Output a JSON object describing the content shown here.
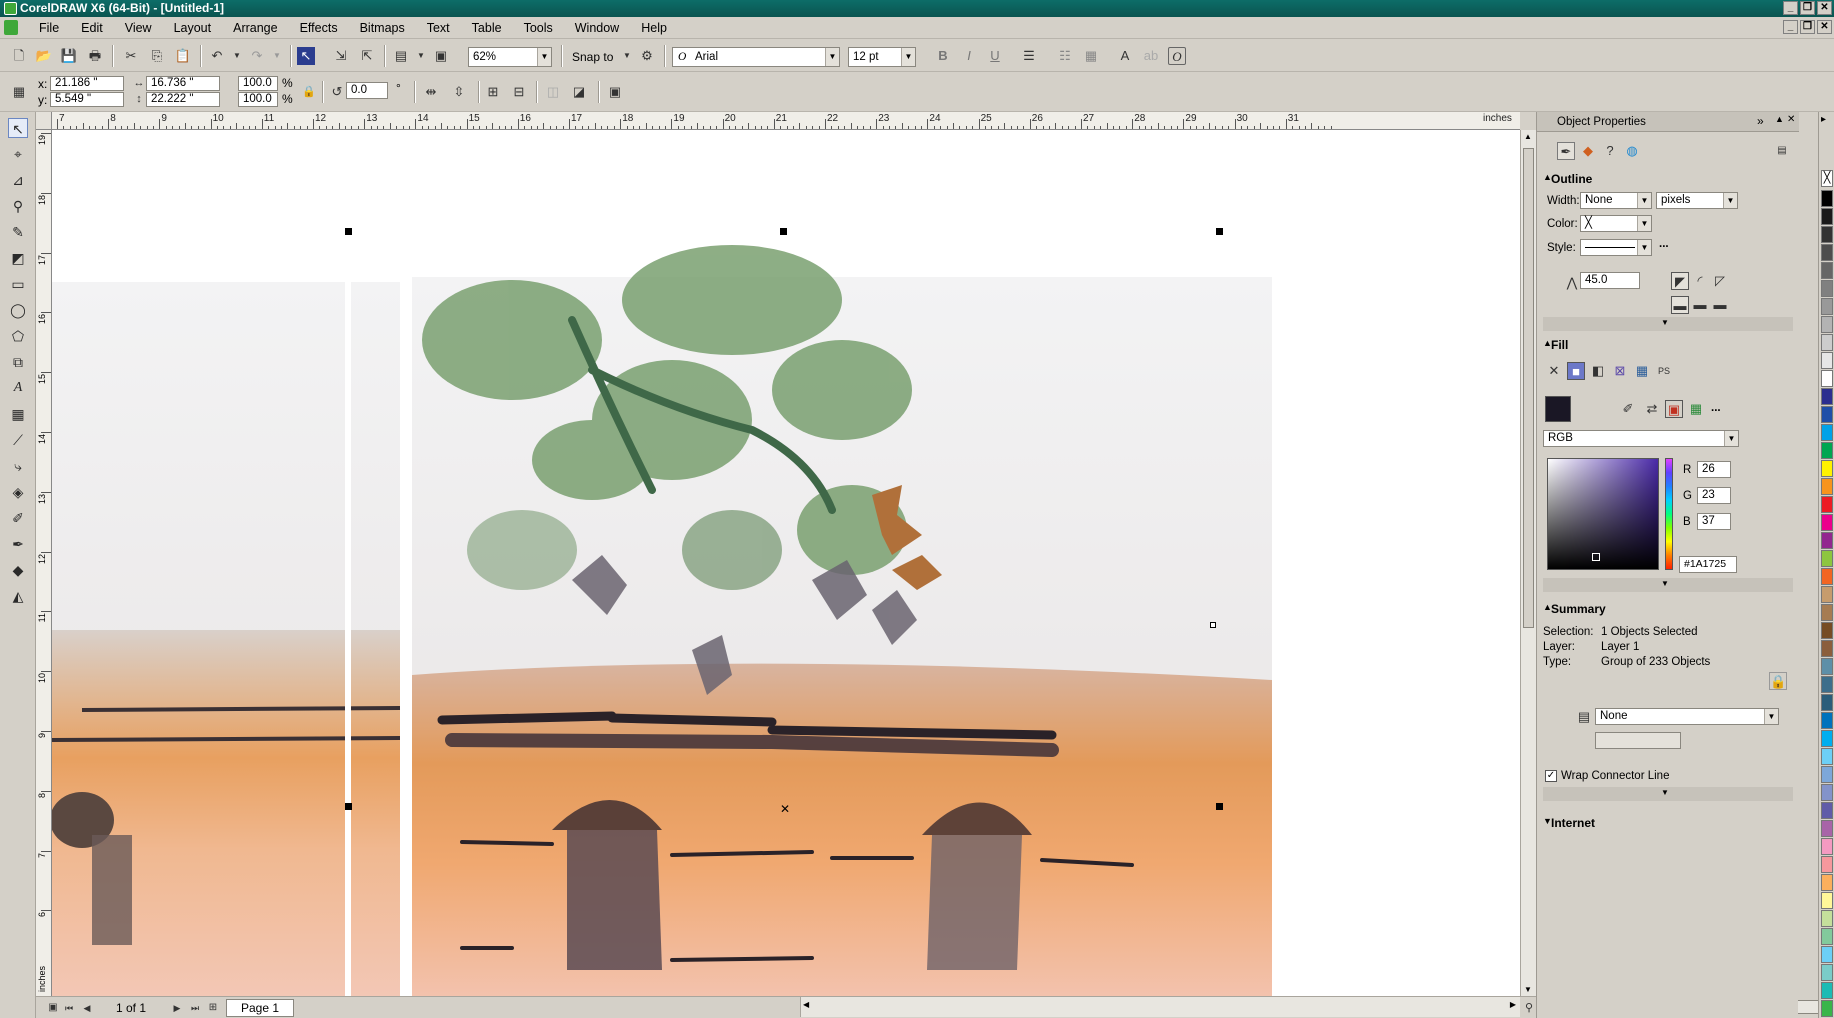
{
  "window": {
    "title": "CorelDRAW X6 (64-Bit) - [Untitled-1]"
  },
  "menu": [
    "File",
    "Edit",
    "View",
    "Layout",
    "Arrange",
    "Effects",
    "Bitmaps",
    "Text",
    "Table",
    "Tools",
    "Window",
    "Help"
  ],
  "toolbar": {
    "zoom": "62%",
    "snap_label": "Snap to",
    "font_name": "Arial",
    "font_size": "12 pt"
  },
  "propbar": {
    "x_label": "x:",
    "x_value": "21.186 \"",
    "y_label": "y:",
    "y_value": "5.549 \"",
    "width_value": "16.736 \"",
    "height_value": "22.222 \"",
    "scale_w": "100.0",
    "scale_h": "100.0",
    "percent": "%",
    "rotation": "0.0",
    "degree": "°"
  },
  "ruler": {
    "unit": "inches",
    "top_labels": [
      "7",
      "8",
      "9",
      "10",
      "11",
      "12",
      "13",
      "14",
      "15",
      "16",
      "17",
      "18",
      "19",
      "20",
      "21",
      "22",
      "23",
      "24",
      "25",
      "26",
      "27",
      "28",
      "29",
      "30",
      "31"
    ],
    "left_labels": [
      "19",
      "18",
      "17",
      "16",
      "15",
      "14",
      "13",
      "12",
      "11",
      "10",
      "9",
      "8",
      "7",
      "6"
    ],
    "left_unit": "inches"
  },
  "status": {
    "page_count": "1 of 1",
    "page_tab": "Page 1"
  },
  "panel": {
    "title": "Object Properties",
    "outline": {
      "header": "Outline",
      "width_label": "Width:",
      "width_value": "None",
      "unit_value": "pixels",
      "color_label": "Color:",
      "style_label": "Style:",
      "style_more": "...",
      "miter_value": "45.0"
    },
    "fill": {
      "header": "Fill",
      "model": "RGB",
      "more": "...",
      "r_label": "R",
      "r_value": "26",
      "g_label": "G",
      "g_value": "23",
      "b_label": "B",
      "b_value": "37",
      "hex": "#1A1725",
      "swatch_color": "#1a1725"
    },
    "summary": {
      "header": "Summary",
      "selection_label": "Selection:",
      "selection_value": "1 Objects Selected",
      "layer_label": "Layer:",
      "layer_value": "Layer 1",
      "type_label": "Type:",
      "type_value": "Group of 233 Objects",
      "style_value": "None",
      "wrap_label": "Wrap Connector Line",
      "wrap_checked": true
    },
    "internet": {
      "header": "Internet"
    }
  },
  "palette": [
    "#000000",
    "#1a1a1a",
    "#333333",
    "#4d4d4d",
    "#666666",
    "#808080",
    "#999999",
    "#b3b3b3",
    "#cccccc",
    "#e6e6e6",
    "#ffffff",
    "#2b2e8f",
    "#1f4fa8",
    "#00a2e8",
    "#00a651",
    "#fff200",
    "#f7941d",
    "#ed1c24",
    "#ec008c",
    "#92278f",
    "#8dc63f",
    "#f26522",
    "#c69c6d",
    "#a67c52",
    "#754c24",
    "#8b5e3c",
    "#5e8fa8",
    "#3d6e8b",
    "#2a5d7a",
    "#0072bc",
    "#00aeef",
    "#6dcff6",
    "#7da7d9",
    "#8393ca",
    "#605ca8",
    "#a864a8",
    "#f49ac1",
    "#f6989d",
    "#fbaf5d",
    "#fff799",
    "#c4df9b",
    "#82ca9c",
    "#6ccff6",
    "#7accc8",
    "#1cbbb4",
    "#39b54a"
  ]
}
